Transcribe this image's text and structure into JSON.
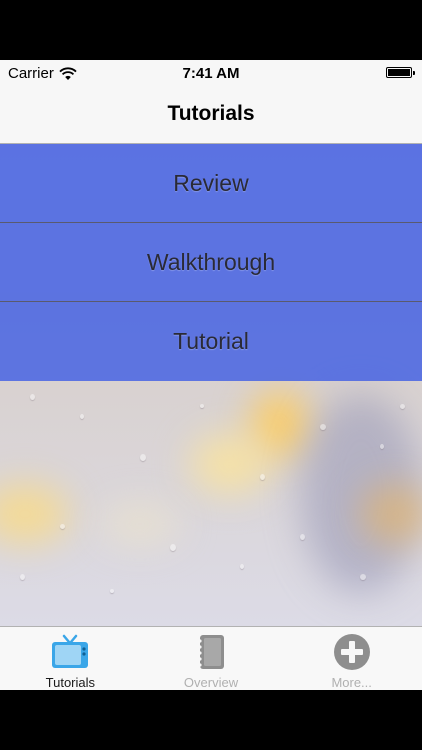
{
  "status_bar": {
    "carrier": "Carrier",
    "time": "7:41 AM",
    "battery_level": 1.0
  },
  "nav": {
    "title": "Tutorials"
  },
  "menu": {
    "items": [
      {
        "label": "Review"
      },
      {
        "label": "Walkthrough"
      },
      {
        "label": "Tutorial"
      }
    ],
    "row_color": "#4b67e2"
  },
  "tab_bar": {
    "tabs": [
      {
        "label": "Tutorials",
        "icon": "tv-icon",
        "active": true
      },
      {
        "label": "Overview",
        "icon": "notebook-icon",
        "active": false
      },
      {
        "label": "More...",
        "icon": "plus-circle-icon",
        "active": false
      }
    ],
    "active_color": "#3aa6e8",
    "inactive_color": "#8e8e8e"
  }
}
